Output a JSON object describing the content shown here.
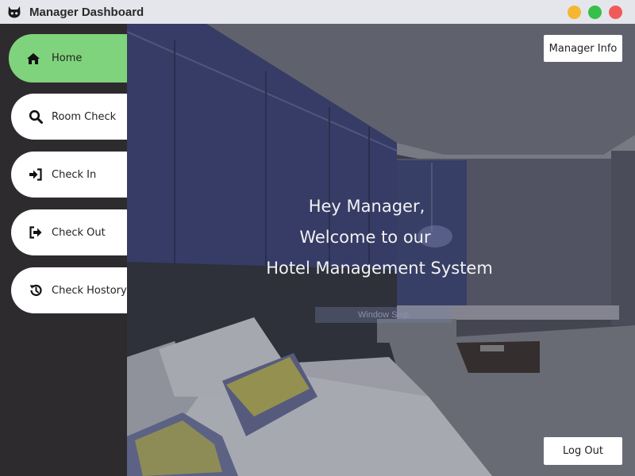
{
  "window": {
    "title": "Manager Dashboard",
    "icon": "cat-icon",
    "controls": [
      "minimize",
      "maximize",
      "close"
    ],
    "colors": {
      "minimize": "#f5b731",
      "maximize": "#34c049",
      "close": "#f25a5a"
    }
  },
  "sidebar": {
    "items": [
      {
        "label": "Home",
        "icon": "home-icon",
        "active": true
      },
      {
        "label": "Room Check",
        "icon": "search-icon",
        "active": false
      },
      {
        "label": "Check In",
        "icon": "sign-in-icon",
        "active": false
      },
      {
        "label": "Check Out",
        "icon": "sign-out-icon",
        "active": false
      },
      {
        "label": "Check Hostory",
        "icon": "history-icon",
        "active": false
      }
    ],
    "active_color": "#7fd37c"
  },
  "main": {
    "greeting_line1": "Hey Manager,",
    "greeting_line2": "Welcome to our",
    "greeting_line3": "Hotel Management System",
    "watermark": "Window Snip",
    "manager_info_label": "Manager Info",
    "logout_label": "Log Out"
  }
}
